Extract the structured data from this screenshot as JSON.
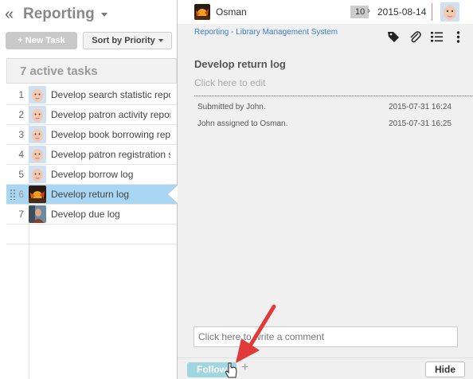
{
  "header": {
    "collapse_glyph": "«",
    "project": "Reporting"
  },
  "toolbar": {
    "new_task": "+ New Task",
    "sort": "Sort by Priority"
  },
  "list": {
    "heading": "7 active tasks",
    "tasks": [
      {
        "num": "1",
        "title": "Develop search statistic report",
        "avatar": "baby"
      },
      {
        "num": "2",
        "title": "Develop patron activity report",
        "avatar": "baby"
      },
      {
        "num": "3",
        "title": "Develop book borrowing report",
        "avatar": "baby"
      },
      {
        "num": "4",
        "title": "Develop patron registration statistic",
        "avatar": "baby"
      },
      {
        "num": "5",
        "title": "Develop borrow log",
        "avatar": "baby"
      },
      {
        "num": "6",
        "title": "Develop return log",
        "avatar": "sunset",
        "selected": true
      },
      {
        "num": "7",
        "title": "Develop due log",
        "avatar": "person"
      }
    ]
  },
  "detail": {
    "assignee": "Osman",
    "priority": "10",
    "due_date": "2015-08-14",
    "breadcrumb": "Reporting - Library Management System",
    "title": "Develop return log",
    "edit_hint": "Click here to edit",
    "activity": [
      {
        "text": "Submitted by John.",
        "time": "2015-07-31 16:24"
      },
      {
        "text": "John assigned to Osman.",
        "time": "2015-07-31 16:25"
      }
    ],
    "comment_placeholder": "Click here to write a comment",
    "follow": "Follow",
    "add": "+",
    "hide": "Hide"
  },
  "colors": {
    "selected_row": "#a9d6f2",
    "link": "#3a7fc4",
    "follow_button": "#9fd6e0",
    "annotation_arrow": "#e03a3a"
  }
}
